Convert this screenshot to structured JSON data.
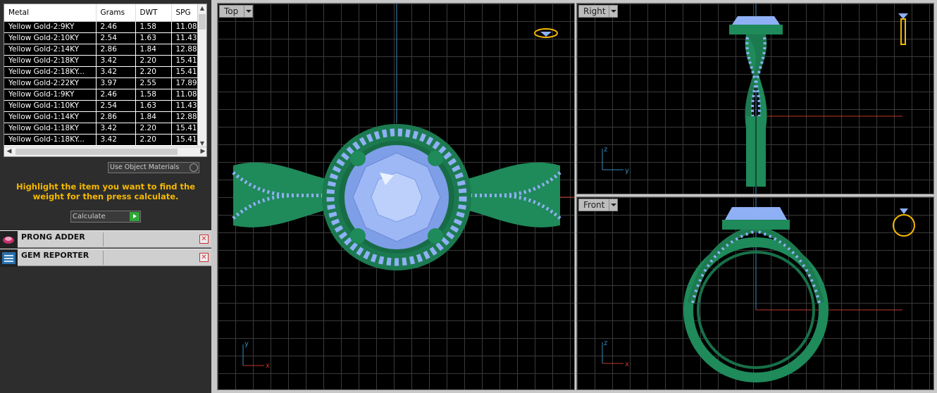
{
  "metal_table": {
    "headers": [
      "Metal",
      "Grams",
      "DWT",
      "SPG"
    ],
    "rows": [
      [
        "Yellow Gold-2:9KY",
        "2.46",
        "1.58",
        "11.08"
      ],
      [
        "Yellow Gold-2:10KY",
        "2.54",
        "1.63",
        "11.43"
      ],
      [
        "Yellow Gold-2:14KY",
        "2.86",
        "1.84",
        "12.88"
      ],
      [
        "Yellow Gold-2:18KY",
        "3.42",
        "2.20",
        "15.41"
      ],
      [
        "Yellow Gold-2:18KY...",
        "3.42",
        "2.20",
        "15.41"
      ],
      [
        "Yellow Gold-2:22KY",
        "3.97",
        "2.55",
        "17.89"
      ],
      [
        "Yellow Gold-1:9KY",
        "2.46",
        "1.58",
        "11.08"
      ],
      [
        "Yellow Gold-1:10KY",
        "2.54",
        "1.63",
        "11.43"
      ],
      [
        "Yellow Gold-1:14KY",
        "2.86",
        "1.84",
        "12.88"
      ],
      [
        "Yellow Gold-1:18KY",
        "3.42",
        "2.20",
        "15.41"
      ],
      [
        "Yellow Gold-1:18KY...",
        "3.42",
        "2.20",
        "15.41"
      ]
    ]
  },
  "controls": {
    "use_object_materials": "Use Object Materials",
    "hint": "Highlight the item you want to find the weight for then press calculate.",
    "calculate": "Calculate"
  },
  "plugins": [
    {
      "name": "PRONG ADDER",
      "icon": "prong-adder-icon"
    },
    {
      "name": "GEM REPORTER",
      "icon": "gem-reporter-icon"
    }
  ],
  "viewports": {
    "top": {
      "label": "Top",
      "axes": [
        "y",
        "x"
      ]
    },
    "right": {
      "label": "Right",
      "axes": [
        "z",
        "y"
      ]
    },
    "front": {
      "label": "Front",
      "axes": [
        "z",
        "x"
      ]
    }
  },
  "colors": {
    "metal": "#1f8a5a",
    "gem": "#8fb0f5",
    "accent": "#f5b800",
    "axis_red": "#c0392b",
    "axis_blue": "#3a8ab8"
  }
}
